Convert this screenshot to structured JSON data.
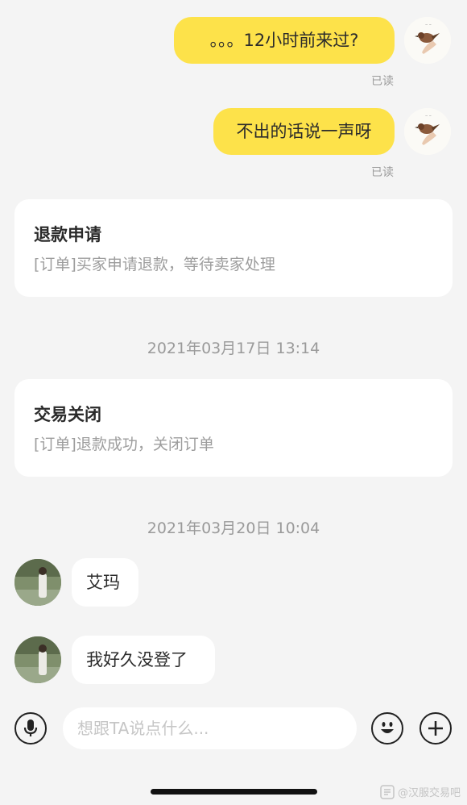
{
  "messages_out": [
    {
      "text": "。。。12小时前来过?",
      "status": "已读"
    },
    {
      "text": "不出的话说一声呀",
      "status": "已读"
    }
  ],
  "cards": [
    {
      "title": "退款申请",
      "subtitle": "[订单]买家申请退款，等待卖家处理"
    },
    {
      "title": "交易关闭",
      "subtitle": "[订单]退款成功，关闭订单"
    }
  ],
  "timestamps": [
    "2021年03月17日 13:14",
    "2021年03月20日 10:04"
  ],
  "messages_in": [
    {
      "text": "艾玛"
    },
    {
      "text": "我好久没登了"
    }
  ],
  "composer": {
    "placeholder": "想跟TA说点什么...",
    "voice_icon": "microphone-icon",
    "emoji_icon": "smiley-icon",
    "add_icon": "plus-icon"
  },
  "watermark": "@汉服交易吧",
  "colors": {
    "bubble_out": "#fde24a",
    "background": "#f4f4f4"
  }
}
